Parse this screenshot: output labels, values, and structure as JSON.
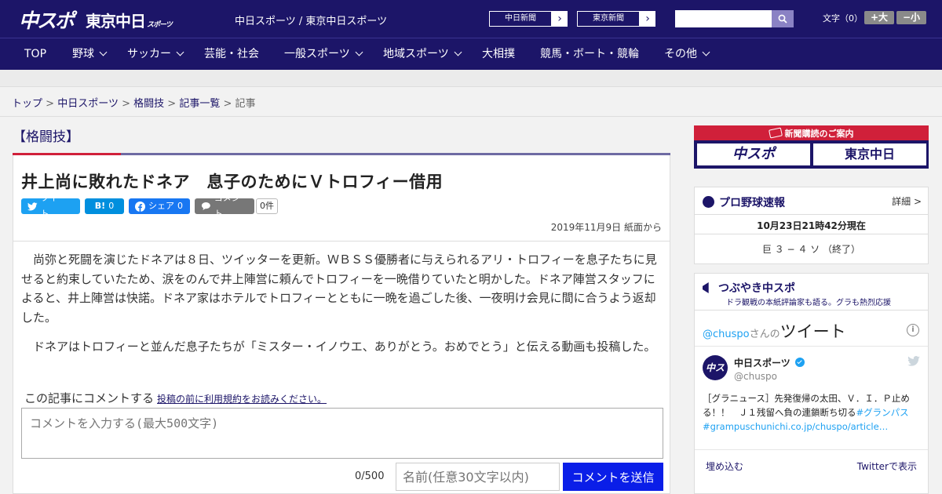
{
  "header": {
    "logo_chuspo": "中スポ",
    "logo_tokyo": "東京中日",
    "logo_tokyo_sub": "スポーツ",
    "tagline": "中日スポーツ / 東京中日スポーツ",
    "paper_links": [
      "中日新聞",
      "東京新聞"
    ],
    "fontsize_label": "文字（0）",
    "fontsize_bigger": "+大",
    "fontsize_smaller": "−小"
  },
  "nav": {
    "items": [
      {
        "label": "TOP"
      },
      {
        "label": "野球"
      },
      {
        "label": "サッカー"
      },
      {
        "label": "芸能・社会"
      },
      {
        "label": "一般スポーツ"
      },
      {
        "label": "地域スポーツ"
      },
      {
        "label": "大相撲"
      },
      {
        "label": "競馬・ボート・競輪"
      },
      {
        "label": "その他"
      }
    ]
  },
  "breadcrumb": {
    "items": [
      "トップ",
      "中日スポーツ",
      "格闘技",
      "記事一覧"
    ],
    "current": "記事",
    "separator": ">"
  },
  "article": {
    "category": "【格闘技】",
    "headline": "井上尚に敗れたドネア　息子のためにＶトロフィー借用",
    "share": {
      "tweet": "ツイート",
      "hatena": "B!",
      "hatena_count": "0",
      "facebook": "シェア",
      "facebook_count": "0",
      "comment": "コメント",
      "comment_count": "0件"
    },
    "dateline": "2019年11月9日 紙面から",
    "paragraphs": [
      "尚弥と死闘を演じたドネアは８日、ツイッターを更新。ＷＢＳＳ優勝者に与えられるアリ・トロフィーを息子たちに見せると約束していたため、涙をのんで井上陣営に頼んでトロフィーを一晩借りていたと明かした。ドネア陣営スタッフによると、井上陣営は快諾。ドネア家はホテルでトロフィーとともに一晩を過ごした後、一夜明け会見に間に合うよう返却した。",
      "ドネアはトロフィーと並んだ息子たちが「ミスター・イノウエ、ありがとう。おめでとう」と伝える動画も投稿した。"
    ],
    "comment_form": {
      "prompt": "この記事にコメントする",
      "rules_link": "投稿の前に利用規約をお読みください。",
      "placeholder": "コメントを入力する(最大500文字)",
      "count": "0/500",
      "name_placeholder": "名前(任意30文字以内)",
      "submit": "コメントを送信"
    }
  },
  "sidebar": {
    "subscription": {
      "title": "新聞購読のご案内",
      "left": "中スポ",
      "right": "東京中日"
    },
    "baseball": {
      "title": "プロ野球速報",
      "detail": "詳細 >",
      "updated": "10月23日21時42分現在",
      "score": "巨 ３ − ４ ソ （終了）"
    },
    "tweets": {
      "title": "つぶやき中スポ",
      "subtitle": "ドラ観戦の本紙評論家も語る。グラも熱烈応援",
      "handle_prefix": "@chuspo",
      "handle_suffix": "さんの",
      "heading": "ツイート",
      "account_name": "中日スポーツ",
      "account_handle": "@chuspo",
      "tweet_text": "［グラニュース］先発復帰の太田、Ｖ．Ｉ．Ｐ止める！！　Ｊ１残留へ負の連鎖断ち切る",
      "tweet_hashtag": "#グランパス",
      "tweet_link": "#grampuschunichi.co.jp/chuspo/article…",
      "embed": "埋め込む",
      "view_on_twitter": "Twitterで表示"
    }
  },
  "colors": {
    "brand_navy": "#1c1568",
    "accent_red": "#d0203a",
    "submit_blue": "#0a1ee8",
    "twitter_blue": "#1da1f2"
  }
}
